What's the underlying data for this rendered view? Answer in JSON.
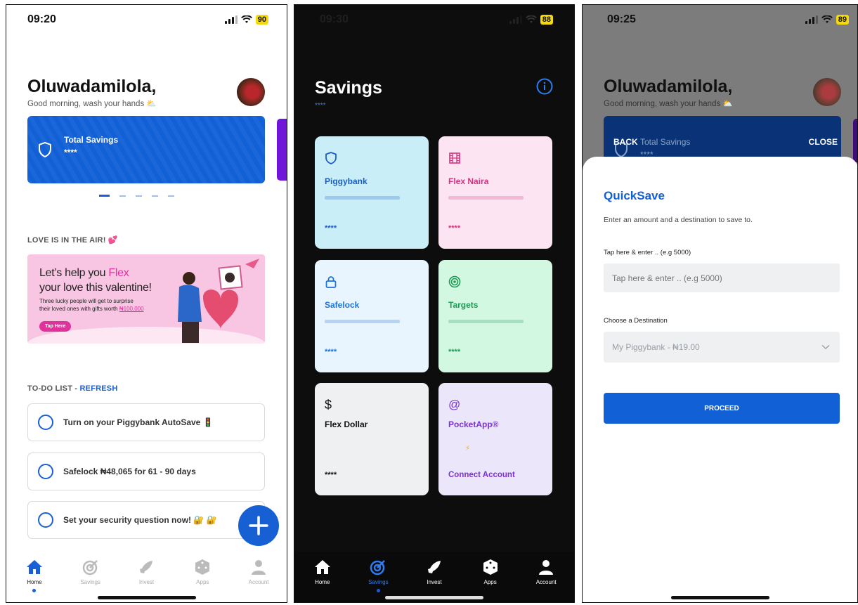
{
  "screen1": {
    "status": {
      "time": "09:20",
      "battery": "90"
    },
    "greeting": "Oluwadamilola,",
    "subgreeting": "Good morning, wash your hands ⛅",
    "savings_card": {
      "title": "Total Savings",
      "amount": "****"
    },
    "promo_section": "LOVE IS IN THE AIR! 💕",
    "banner": {
      "line1a": "Let’s help you ",
      "line1b": "Flex",
      "line2": "your love this valentine!",
      "desc1": "Three lucky people will get to surprise",
      "desc2a": "their loved ones with gifts worth ",
      "desc2b": "₦100,000",
      "button": "Tap Here"
    },
    "todo_label": "TO-DO LIST - ",
    "todo_refresh": "REFRESH",
    "todos": [
      "Turn on your Piggybank AutoSave 🚦",
      "Safelock ₦48,065 for 61 - 90 days",
      "Set your security question now! 🔐 🔐"
    ],
    "tabs": [
      "Home",
      "Savings",
      "Invest",
      "Apps",
      "Account"
    ]
  },
  "screen2": {
    "status": {
      "time": "09:30",
      "battery": "88"
    },
    "title": "Savings",
    "subtitle": "****",
    "cards": [
      {
        "name": "Piggybank",
        "balance": "****"
      },
      {
        "name": "Flex Naira",
        "balance": "****"
      },
      {
        "name": "Safelock",
        "balance": "****"
      },
      {
        "name": "Targets",
        "balance": "****"
      },
      {
        "name": "Flex Dollar",
        "balance": "****"
      },
      {
        "name": "PocketApp®",
        "action": "Connect Account"
      }
    ],
    "tabs": [
      "Home",
      "Savings",
      "Invest",
      "Apps",
      "Account"
    ]
  },
  "screen3": {
    "status": {
      "time": "09:25",
      "battery": "89"
    },
    "greeting": "Oluwadamilola,",
    "subgreeting": "Good morning, wash your hands ⛅",
    "back": "BACK",
    "close": "CLOSE",
    "savings_card_title": "Total Savings",
    "savings_card_amount": "****",
    "sheet_title": "QuickSave",
    "sheet_desc": "Enter an amount and a destination to save to.",
    "amount_label": "Tap here & enter .. (e.g 5000)",
    "amount_placeholder": "Tap here & enter .. (e.g 5000)",
    "destination_label": "Choose a Destination",
    "destination_value": "My Piggybank - ₦19.00",
    "proceed": "PROCEED"
  },
  "colors": {
    "primary": "#1260d6",
    "piggy": "#c9eef8",
    "flex_naira": "#fde4f2",
    "safelock": "#e9f5fe",
    "targets": "#d3f8e2",
    "flex_dollar": "#eef0f2",
    "pocket": "#ece6fb"
  }
}
